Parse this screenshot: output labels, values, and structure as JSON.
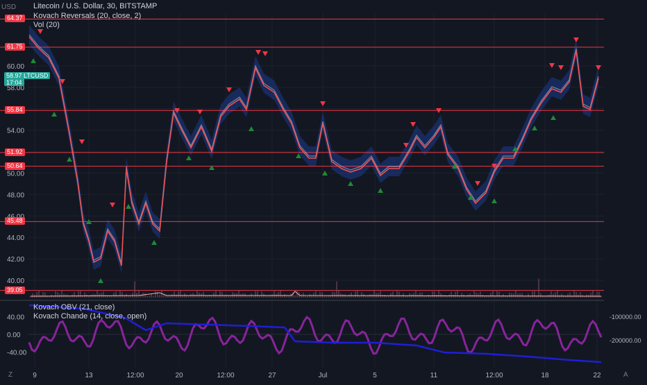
{
  "header": {
    "currency": "USD",
    "title": "Litecoin / U.S. Dollar, 30, BITSTAMP",
    "indicator1": "Kovach Reversals (20, close, 2)",
    "indicator2": "Vol (20)"
  },
  "price_axis": {
    "ticks": [
      "60.00",
      "58.00",
      "56.00",
      "54.00",
      "52.00",
      "50.00",
      "48.00",
      "46.00",
      "44.00",
      "42.00",
      "40.00"
    ]
  },
  "levels": [
    {
      "value": 64.37,
      "label": "64.37"
    },
    {
      "value": 61.75,
      "label": "61.75"
    },
    {
      "value": 55.84,
      "label": "55.84"
    },
    {
      "value": 51.92,
      "label": "51.92"
    },
    {
      "value": 50.64,
      "label": "50.64"
    },
    {
      "value": 45.48,
      "label": "45.48"
    },
    {
      "value": 39.05,
      "label": "39.05"
    }
  ],
  "current": {
    "price": "58.97",
    "symbol": "LTCUSD",
    "countdown": "17:04"
  },
  "lower": {
    "obv_label": "Kovach OBV (21, close)",
    "chande_label": "Kovach Chande (14, close, open)",
    "left_ticks": [
      "40.00",
      "0.00",
      "-40.00"
    ],
    "right_ticks": [
      "-100000.00",
      "-200000.00"
    ]
  },
  "time_axis": {
    "ticks": [
      "9",
      "13",
      "12:00",
      "20",
      "12:00",
      "27",
      "Jul",
      "5",
      "11",
      "12:00",
      "18",
      "22"
    ]
  },
  "corner_left": "Z",
  "corner_right": "A",
  "colors": {
    "bg": "#131722",
    "level": "#f23645",
    "current": "#26a69a",
    "chande": "#9c27b0",
    "obv": "#1f1fd6",
    "price": "#ef5350",
    "band": "#1c3a8a"
  }
}
